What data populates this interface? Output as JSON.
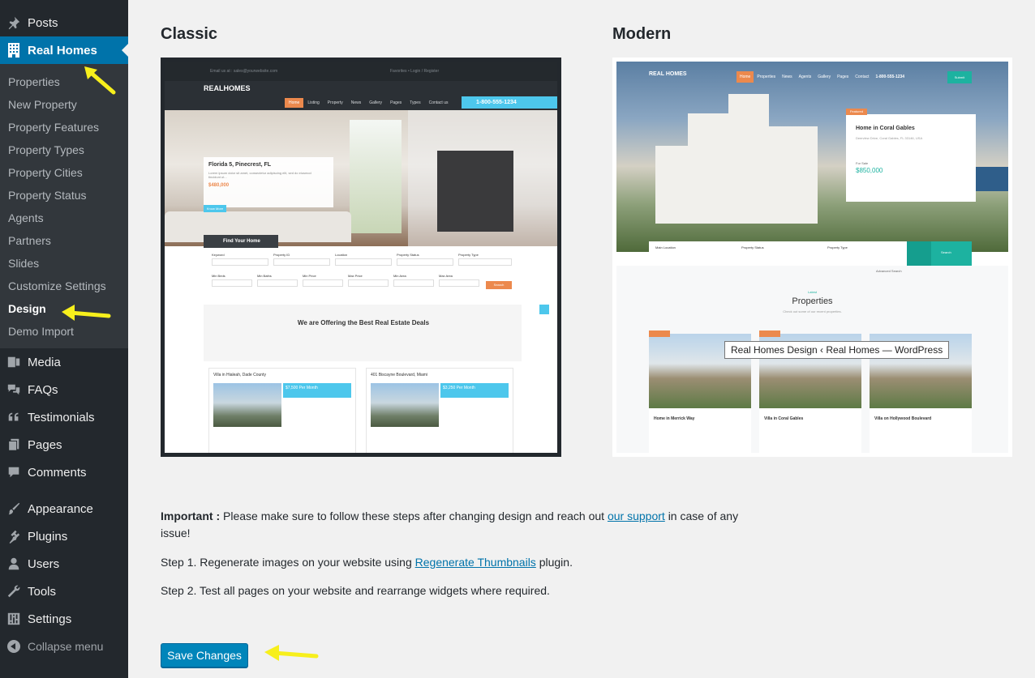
{
  "sidebar": {
    "items": [
      {
        "label": "Posts",
        "icon": "pin-icon"
      },
      {
        "label": "Real Homes",
        "icon": "building-icon",
        "current": true
      },
      {
        "label": "Media",
        "icon": "media-icon"
      },
      {
        "label": "FAQs",
        "icon": "comments-icon"
      },
      {
        "label": "Testimonials",
        "icon": "quote-icon"
      },
      {
        "label": "Pages",
        "icon": "page-icon"
      },
      {
        "label": "Comments",
        "icon": "comment-icon"
      },
      {
        "label": "Appearance",
        "icon": "brush-icon"
      },
      {
        "label": "Plugins",
        "icon": "plugin-icon"
      },
      {
        "label": "Users",
        "icon": "user-icon"
      },
      {
        "label": "Tools",
        "icon": "wrench-icon"
      },
      {
        "label": "Settings",
        "icon": "sliders-icon"
      }
    ],
    "submenu": [
      "Properties",
      "New Property",
      "Property Features",
      "Property Types",
      "Property Cities",
      "Property Status",
      "Agents",
      "Partners",
      "Slides",
      "Customize Settings",
      "Design",
      "Demo Import"
    ],
    "collapse_label": "Collapse menu"
  },
  "designs": {
    "classic": {
      "title": "Classic",
      "mock": {
        "email": "Email us at : sales@yourwebsite.com",
        "topbar_links": "Favorites  •  Login / Register",
        "logo": "REALHOMES",
        "nav": [
          "Home",
          "Listing",
          "Property",
          "News",
          "Gallery",
          "Pages",
          "Types",
          "Contact us"
        ],
        "phone": "1-800-555-1234",
        "hero_title": "Florida 5, Pinecrest, FL",
        "hero_desc": "Lorem ipsum dolor sit amet, consectetur adipiscing elit, sed do eiusmod tincidunt ut...",
        "hero_price": "$480,000",
        "hero_button": "Know More",
        "find_home": "Find Your Home",
        "search_fields": [
          "Keyword",
          "Property ID",
          "Location",
          "Property Status",
          "Property Type",
          "Min Beds",
          "Min Baths",
          "Min Price",
          "Max Price",
          "Min Area",
          "Max Area"
        ],
        "search_button": "Search",
        "offer_title": "We are Offering the Best Real Estate Deals",
        "properties": [
          {
            "title": "Villa in Hialeah, Dade County",
            "price": "$7,500 Per Month"
          },
          {
            "title": "401 Biscayne Boulevard, Miami",
            "price": "$3,250 Per Month"
          }
        ]
      }
    },
    "modern": {
      "title": "Modern",
      "mock": {
        "logo": "REAL HOMES",
        "nav": [
          "Home",
          "Properties",
          "News",
          "Agents",
          "Gallery",
          "Pages",
          "Contact"
        ],
        "phone": "1-800-555-1234",
        "submit": "Submit",
        "featured": "Featured",
        "card_title": "Home in Coral Gables",
        "card_address": "Deervlew Drive, Coral Gables, FL 33146, USA",
        "card_price": "$850,000",
        "card_status": "For Sale",
        "search_fields": [
          "Main Location",
          "Property Status",
          "Property Type"
        ],
        "search_button": "Search",
        "advanced": "Advanced Search",
        "latest": "Latest",
        "section_title": "Properties",
        "section_sub": "Check out some of our recent properties.",
        "properties": [
          "Home in Merrick Way",
          "Villa in Coral Gables",
          "Villa on Hollywood Boulevard"
        ]
      }
    }
  },
  "tooltip": "Real Homes Design ‹ Real Homes — WordPress",
  "notice": {
    "important_label": "Important :",
    "important_text": "Please make sure to follow these steps after changing design and reach out",
    "support_link": "our support",
    "important_tail": "in case of any",
    "important_tail2": "issue!",
    "step1_text": "Step 1. Regenerate images on your website using",
    "step1_link": "Regenerate Thumbnails",
    "step1_tail": "plugin.",
    "step2_text": "Step 2. Test all pages on your website and rearrange widgets where required."
  },
  "save_button": "Save Changes",
  "colors": {
    "sidebar_bg": "#23282d",
    "submenu_bg": "#32373c",
    "accent": "#0073aa",
    "button": "#0085ba",
    "annotation_arrow": "#f7ef1c",
    "classic_orange": "#ec894d",
    "classic_blue": "#4dc7ec",
    "modern_teal": "#1db2a0"
  }
}
